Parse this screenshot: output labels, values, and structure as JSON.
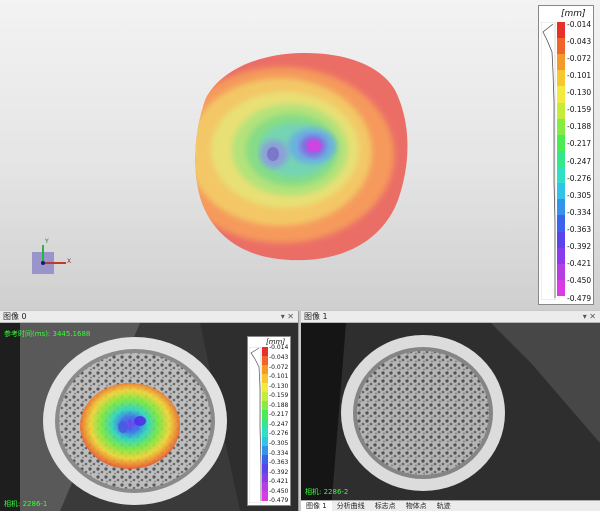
{
  "legend": {
    "unit": "[mm]",
    "ticks": [
      "-0.014",
      "-0.043",
      "-0.072",
      "-0.101",
      "-0.130",
      "-0.159",
      "-0.188",
      "-0.217",
      "-0.247",
      "-0.276",
      "-0.305",
      "-0.334",
      "-0.363",
      "-0.392",
      "-0.421",
      "-0.450",
      "-0.479"
    ],
    "colors": [
      "#e8302a",
      "#f06428",
      "#f59a28",
      "#f8c630",
      "#f2ea3c",
      "#c4ec3c",
      "#86ec44",
      "#4cea54",
      "#34e68c",
      "#30e0c4",
      "#30c4e8",
      "#3494ec",
      "#3a64ee",
      "#5a44ec",
      "#8a3cea",
      "#b63ce6",
      "#d83ce2"
    ]
  },
  "axis_triad": {
    "y": "Y",
    "x": "X"
  },
  "panel0": {
    "title": "图像 0",
    "controls": "▾ ✕",
    "overlay_top": "参考时间(ms): 3445.1688",
    "overlay_bottom": "相机: 2286-1"
  },
  "panel1": {
    "title": "图像 1",
    "controls": "▾ ✕",
    "overlay_bottom": "相机: 2286-2"
  },
  "tabs": [
    "图像 1",
    "分析曲线",
    "标志点",
    "物体点",
    "轨迹"
  ],
  "active_tab": 0
}
